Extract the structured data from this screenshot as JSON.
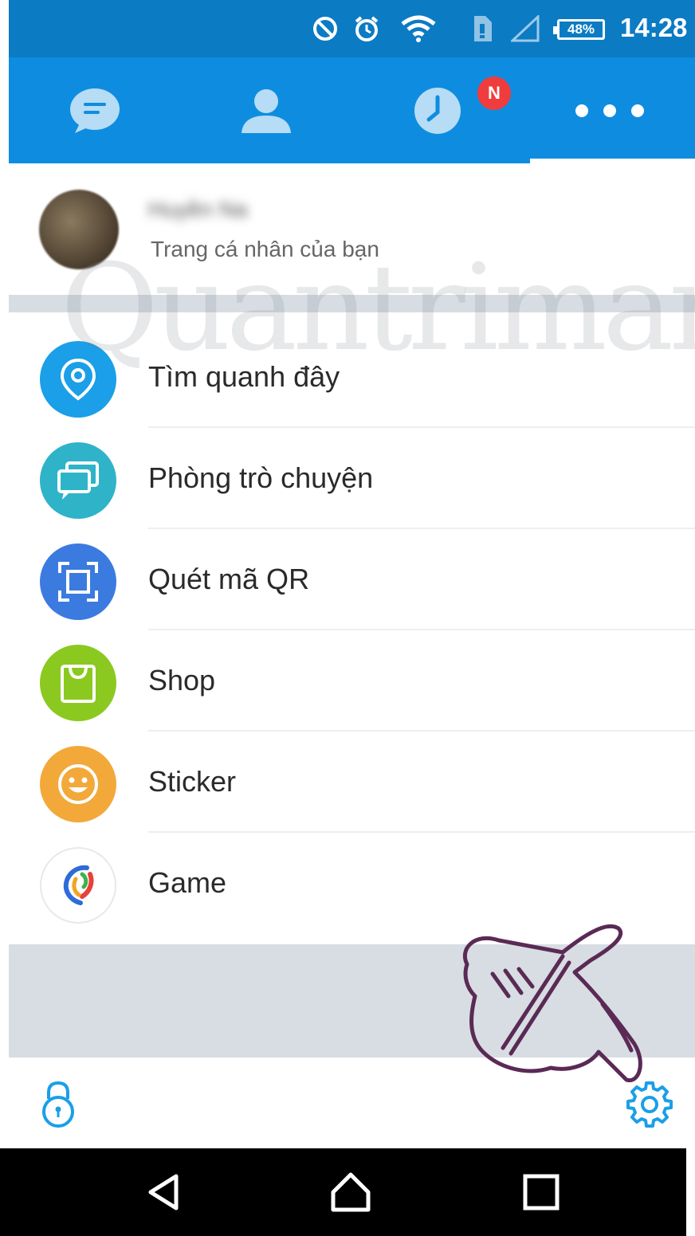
{
  "status_bar": {
    "battery": "48%",
    "time": "14:28",
    "icons": [
      "do-not-disturb-icon",
      "alarm-icon",
      "wifi-icon",
      "sim-icon",
      "signal-icon",
      "battery-icon"
    ]
  },
  "tabs": [
    {
      "name": "chat-icon",
      "active": false
    },
    {
      "name": "contacts-icon",
      "active": false
    },
    {
      "name": "timeline-icon",
      "active": false,
      "badge": "N"
    },
    {
      "name": "more-icon",
      "active": true
    }
  ],
  "profile": {
    "name": "Huyền Na",
    "subtitle": "Trang cá nhân của bạn"
  },
  "menu": [
    {
      "label": "Tìm quanh đây",
      "icon": "location-pin-icon",
      "color": "#1a9fe8"
    },
    {
      "label": "Phòng trò chuyện",
      "icon": "chat-rooms-icon",
      "color": "#2fb3c9"
    },
    {
      "label": "Quét mã QR",
      "icon": "qr-scan-icon",
      "color": "#3b7be0"
    },
    {
      "label": "Shop",
      "icon": "shopping-bag-icon",
      "color": "#8bc920"
    },
    {
      "label": "Sticker",
      "icon": "smiley-icon",
      "color": "#f2a93a"
    },
    {
      "label": "Game",
      "icon": "game-logo-icon",
      "color": "#ffffff"
    }
  ],
  "toolbar": {
    "left_icon": "lock-icon",
    "right_icon": "settings-gear-icon"
  },
  "watermark": "Quantrimang",
  "colors": {
    "status_bar": "#0b7bc4",
    "header": "#0e8de0",
    "accent": "#1a9fe8",
    "badge": "#f03c3c"
  }
}
